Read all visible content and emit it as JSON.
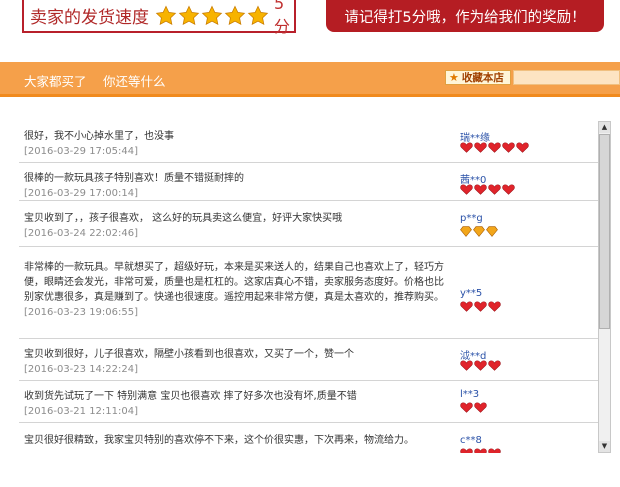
{
  "speed": {
    "label": "卖家的发货速度",
    "stars": 5,
    "score": "5分"
  },
  "reward_text": "请记得打5分哦，作为给我们的奖励！",
  "tabs": [
    "大家都买了",
    "你还等什么"
  ],
  "favorite_label": "收藏本店",
  "colors": {
    "accent_red": "#b51d23",
    "tab_orange": "#f5a04a",
    "star_gold": "#f7b300",
    "heart_red": "#e0242b",
    "diamond_gold": "#f2a61a",
    "user_blue": "#2b52a8"
  },
  "reviews": [
    {
      "text": "很好，我不小心掉水里了，也没事",
      "date": "[2016-03-29 17:05:44]",
      "user": "瑞**缘",
      "badge_type": "heart",
      "badge_count": 5
    },
    {
      "text": "很棒的一款玩具孩子特别喜欢！质量不错挺耐摔的",
      "date": "[2016-03-29 17:00:14]",
      "user": "茜**0",
      "badge_type": "heart",
      "badge_count": 4
    },
    {
      "text": "宝贝收到了，，孩子很喜欢， 这么好的玩具卖这么便宜，好评大家快买哦",
      "date": "[2016-03-24 22:02:46]",
      "user": "p**g",
      "badge_type": "diamond",
      "badge_count": 3
    },
    {
      "text": "非常棒的一款玩具。早就想买了，超级好玩，本来是买来送人的，结果自己也喜欢上了，轻巧方便，眼睛还会发光，非常可爱，质量也是杠杠的。这家店真心不错，卖家服务态度好。价格也比别家优惠很多，真是赚到了。快递也很速度。遥控用起来非常方便，真是太喜欢的，推荐购买。",
      "date": "[2016-03-23 19:06:55]",
      "user": "y**5",
      "badge_type": "heart",
      "badge_count": 3
    },
    {
      "text": "宝贝收到很好，儿子很喜欢，隔壁小孩看到也很喜欢，又买了一个，赞一个",
      "date": "[2016-03-23 14:22:24]",
      "user": "泧**d",
      "badge_type": "heart",
      "badge_count": 3
    },
    {
      "text": "收到货先试玩了一下 特别满意 宝贝也很喜欢 摔了好多次也没有坏,质量不错",
      "date": "[2016-03-21 12:11:04]",
      "user": "l**3",
      "badge_type": "heart",
      "badge_count": 2
    },
    {
      "text": "宝贝很好很精致，我家宝贝特别的喜欢停不下来，这个价很实惠，下次再来，物流给力。",
      "date": "",
      "user": "c**8",
      "badge_type": "heart",
      "badge_count": 3
    }
  ]
}
